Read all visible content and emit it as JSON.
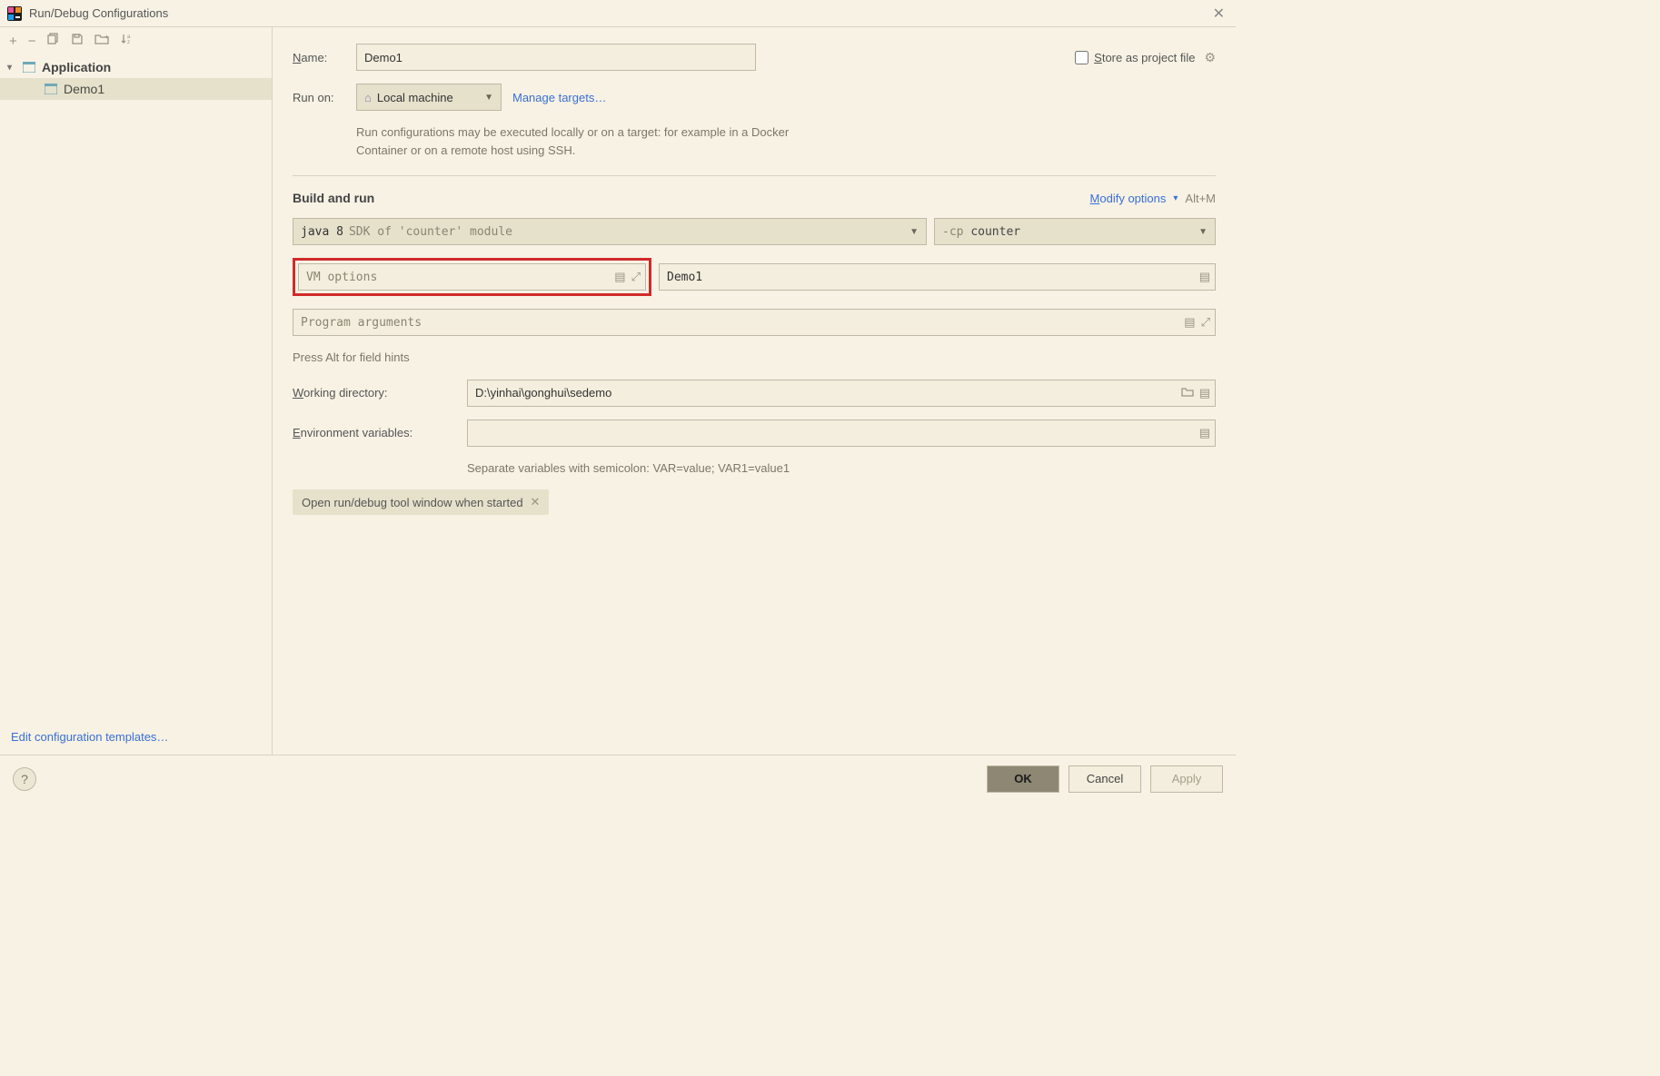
{
  "window": {
    "title": "Run/Debug Configurations"
  },
  "leftToolbar": {
    "add": "+",
    "remove": "−",
    "copy": "copy",
    "save": "save",
    "folder": "folder",
    "sort": "sort"
  },
  "tree": {
    "root": {
      "label": "Application",
      "expanded": true
    },
    "children": [
      {
        "label": "Demo1"
      }
    ]
  },
  "leftFooter": {
    "editTemplates": "Edit configuration templates…"
  },
  "form": {
    "nameLabel": "Name:",
    "nameValue": "Demo1",
    "storeAsProjectFile": "Store as project file",
    "runOnLabel": "Run on:",
    "runOnValue": "Local machine",
    "manageTargets": "Manage targets…",
    "runOnHint": "Run configurations may be executed locally or on a target: for example in a Docker Container or on a remote host using SSH.",
    "buildAndRun": "Build and run",
    "modifyOptions": "Modify options",
    "modifyShortcut": "Alt+M",
    "sdkPrefix": "java 8",
    "sdkSuffix": "SDK of 'counter' module",
    "cpPrefix": "-cp",
    "cpValue": "counter",
    "vmOptionsPlaceholder": "VM options",
    "mainClassValue": "Demo1",
    "programArgsPlaceholder": "Program arguments",
    "fieldHints": "Press Alt for field hints",
    "workingDirLabel": "Working directory:",
    "workingDirValue": "D:\\yinhai\\gonghui\\sedemo",
    "envLabel": "Environment variables:",
    "envValue": "",
    "envHint": "Separate variables with semicolon: VAR=value; VAR1=value1",
    "chipOpenToolWindow": "Open run/debug tool window when started"
  },
  "buttons": {
    "ok": "OK",
    "cancel": "Cancel",
    "apply": "Apply"
  }
}
